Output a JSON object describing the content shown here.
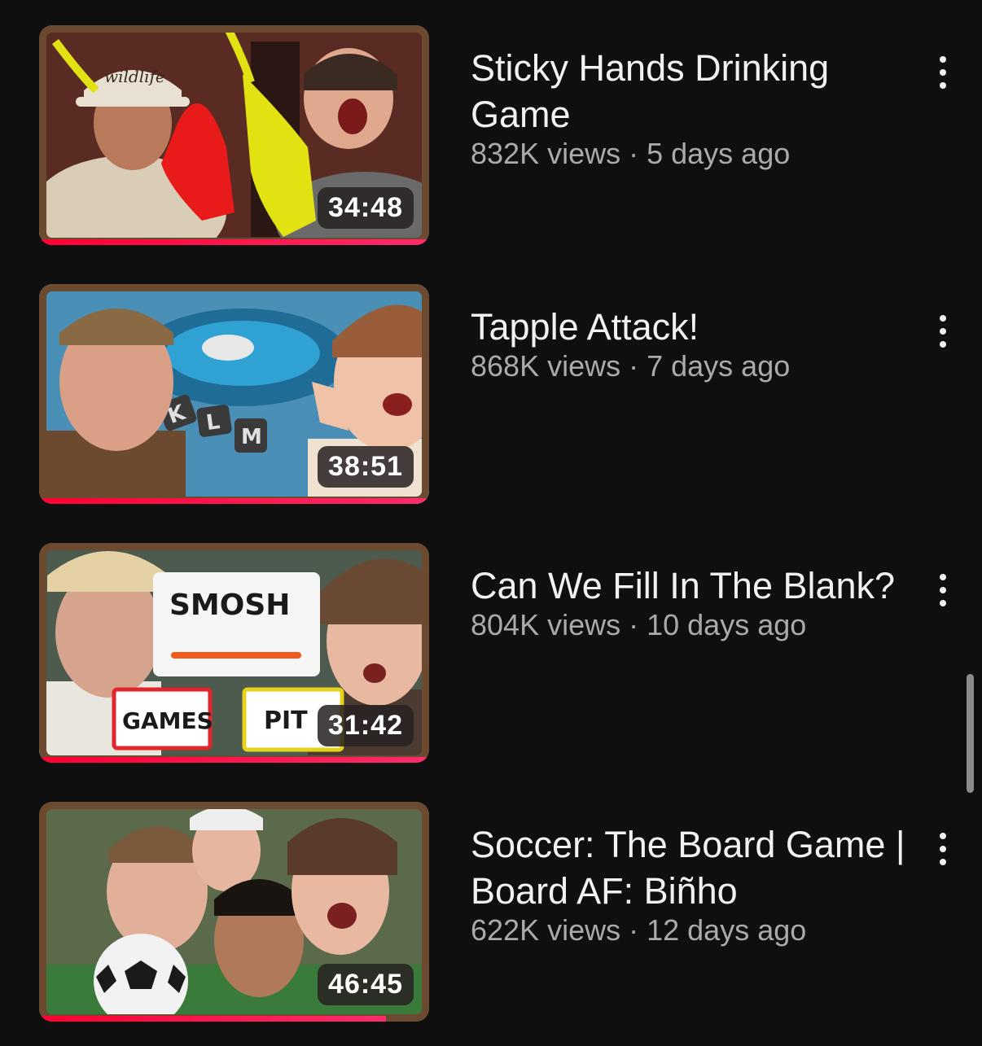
{
  "videos": [
    {
      "title": "Sticky Hands Drinking Game",
      "views": "832K views",
      "age": "5 days ago",
      "duration": "34:48",
      "watched_fraction": 1.0,
      "thumb_text": [
        "wildlife"
      ]
    },
    {
      "title": "Tapple Attack!",
      "views": "868K views",
      "age": "7 days ago",
      "duration": "38:51",
      "watched_fraction": 1.0,
      "thumb_text": [
        "K",
        "L",
        "M"
      ]
    },
    {
      "title": "Can We Fill In The Blank?",
      "views": "804K views",
      "age": "10 days ago",
      "duration": "31:42",
      "watched_fraction": 1.0,
      "thumb_text": [
        "SMOSH",
        "GAMES",
        "PIT"
      ]
    },
    {
      "title": "Soccer: The Board Game | Board AF: Biñho",
      "views": "622K views",
      "age": "12 days ago",
      "duration": "46:45",
      "watched_fraction": 0.89,
      "thumb_text": []
    }
  ],
  "separator": " · ",
  "icons": {
    "more": "more-vert-icon"
  },
  "colors": {
    "background": "#0f0f0f",
    "progress": "#ff0033",
    "title": "#f1f1f1",
    "subtitle": "#aaaaaa"
  }
}
